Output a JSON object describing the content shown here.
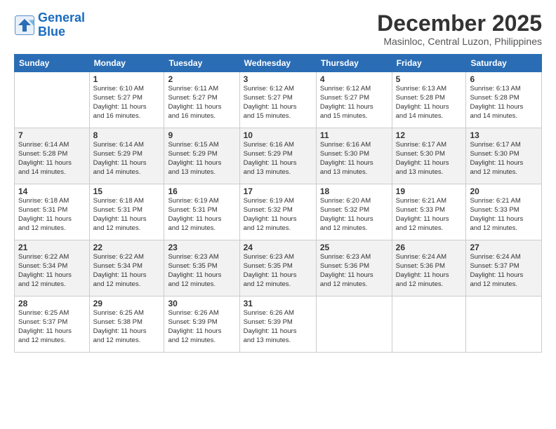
{
  "header": {
    "logo_line1": "General",
    "logo_line2": "Blue",
    "month": "December 2025",
    "location": "Masinloc, Central Luzon, Philippines"
  },
  "days_of_week": [
    "Sunday",
    "Monday",
    "Tuesday",
    "Wednesday",
    "Thursday",
    "Friday",
    "Saturday"
  ],
  "weeks": [
    [
      {
        "day": "",
        "info": ""
      },
      {
        "day": "1",
        "info": "Sunrise: 6:10 AM\nSunset: 5:27 PM\nDaylight: 11 hours\nand 16 minutes."
      },
      {
        "day": "2",
        "info": "Sunrise: 6:11 AM\nSunset: 5:27 PM\nDaylight: 11 hours\nand 16 minutes."
      },
      {
        "day": "3",
        "info": "Sunrise: 6:12 AM\nSunset: 5:27 PM\nDaylight: 11 hours\nand 15 minutes."
      },
      {
        "day": "4",
        "info": "Sunrise: 6:12 AM\nSunset: 5:27 PM\nDaylight: 11 hours\nand 15 minutes."
      },
      {
        "day": "5",
        "info": "Sunrise: 6:13 AM\nSunset: 5:28 PM\nDaylight: 11 hours\nand 14 minutes."
      },
      {
        "day": "6",
        "info": "Sunrise: 6:13 AM\nSunset: 5:28 PM\nDaylight: 11 hours\nand 14 minutes."
      }
    ],
    [
      {
        "day": "7",
        "info": "Sunrise: 6:14 AM\nSunset: 5:28 PM\nDaylight: 11 hours\nand 14 minutes."
      },
      {
        "day": "8",
        "info": "Sunrise: 6:14 AM\nSunset: 5:29 PM\nDaylight: 11 hours\nand 14 minutes."
      },
      {
        "day": "9",
        "info": "Sunrise: 6:15 AM\nSunset: 5:29 PM\nDaylight: 11 hours\nand 13 minutes."
      },
      {
        "day": "10",
        "info": "Sunrise: 6:16 AM\nSunset: 5:29 PM\nDaylight: 11 hours\nand 13 minutes."
      },
      {
        "day": "11",
        "info": "Sunrise: 6:16 AM\nSunset: 5:30 PM\nDaylight: 11 hours\nand 13 minutes."
      },
      {
        "day": "12",
        "info": "Sunrise: 6:17 AM\nSunset: 5:30 PM\nDaylight: 11 hours\nand 13 minutes."
      },
      {
        "day": "13",
        "info": "Sunrise: 6:17 AM\nSunset: 5:30 PM\nDaylight: 11 hours\nand 12 minutes."
      }
    ],
    [
      {
        "day": "14",
        "info": "Sunrise: 6:18 AM\nSunset: 5:31 PM\nDaylight: 11 hours\nand 12 minutes."
      },
      {
        "day": "15",
        "info": "Sunrise: 6:18 AM\nSunset: 5:31 PM\nDaylight: 11 hours\nand 12 minutes."
      },
      {
        "day": "16",
        "info": "Sunrise: 6:19 AM\nSunset: 5:31 PM\nDaylight: 11 hours\nand 12 minutes."
      },
      {
        "day": "17",
        "info": "Sunrise: 6:19 AM\nSunset: 5:32 PM\nDaylight: 11 hours\nand 12 minutes."
      },
      {
        "day": "18",
        "info": "Sunrise: 6:20 AM\nSunset: 5:32 PM\nDaylight: 11 hours\nand 12 minutes."
      },
      {
        "day": "19",
        "info": "Sunrise: 6:21 AM\nSunset: 5:33 PM\nDaylight: 11 hours\nand 12 minutes."
      },
      {
        "day": "20",
        "info": "Sunrise: 6:21 AM\nSunset: 5:33 PM\nDaylight: 11 hours\nand 12 minutes."
      }
    ],
    [
      {
        "day": "21",
        "info": "Sunrise: 6:22 AM\nSunset: 5:34 PM\nDaylight: 11 hours\nand 12 minutes."
      },
      {
        "day": "22",
        "info": "Sunrise: 6:22 AM\nSunset: 5:34 PM\nDaylight: 11 hours\nand 12 minutes."
      },
      {
        "day": "23",
        "info": "Sunrise: 6:23 AM\nSunset: 5:35 PM\nDaylight: 11 hours\nand 12 minutes."
      },
      {
        "day": "24",
        "info": "Sunrise: 6:23 AM\nSunset: 5:35 PM\nDaylight: 11 hours\nand 12 minutes."
      },
      {
        "day": "25",
        "info": "Sunrise: 6:23 AM\nSunset: 5:36 PM\nDaylight: 11 hours\nand 12 minutes."
      },
      {
        "day": "26",
        "info": "Sunrise: 6:24 AM\nSunset: 5:36 PM\nDaylight: 11 hours\nand 12 minutes."
      },
      {
        "day": "27",
        "info": "Sunrise: 6:24 AM\nSunset: 5:37 PM\nDaylight: 11 hours\nand 12 minutes."
      }
    ],
    [
      {
        "day": "28",
        "info": "Sunrise: 6:25 AM\nSunset: 5:37 PM\nDaylight: 11 hours\nand 12 minutes."
      },
      {
        "day": "29",
        "info": "Sunrise: 6:25 AM\nSunset: 5:38 PM\nDaylight: 11 hours\nand 12 minutes."
      },
      {
        "day": "30",
        "info": "Sunrise: 6:26 AM\nSunset: 5:39 PM\nDaylight: 11 hours\nand 12 minutes."
      },
      {
        "day": "31",
        "info": "Sunrise: 6:26 AM\nSunset: 5:39 PM\nDaylight: 11 hours\nand 13 minutes."
      },
      {
        "day": "",
        "info": ""
      },
      {
        "day": "",
        "info": ""
      },
      {
        "day": "",
        "info": ""
      }
    ]
  ]
}
